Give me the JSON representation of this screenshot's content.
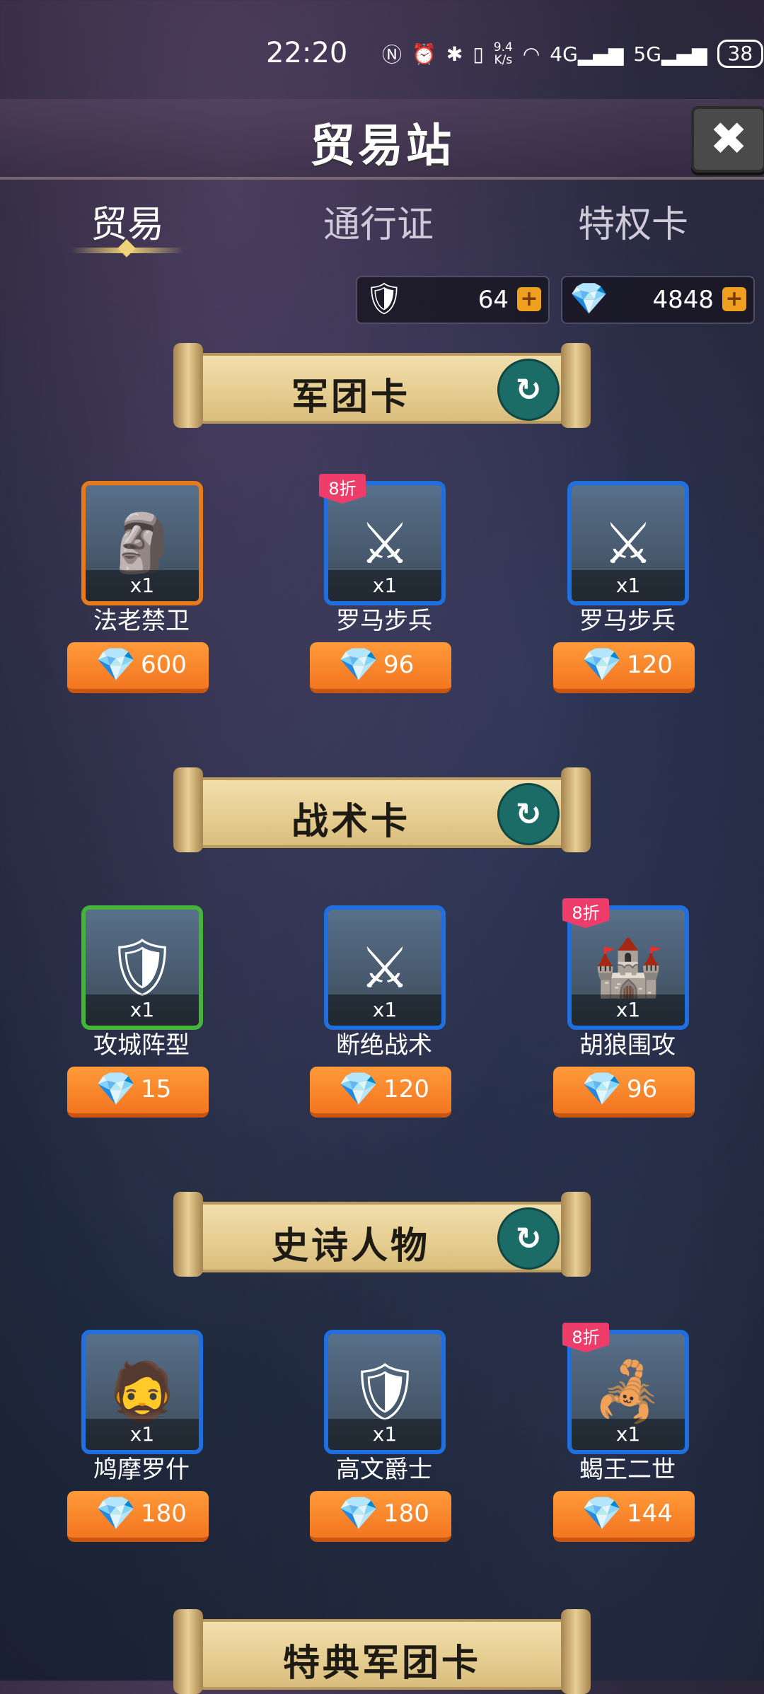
{
  "status": {
    "time": "22:20",
    "net_speed": "9.4\nK/s",
    "battery": "38"
  },
  "title": "贸易站",
  "tabs": [
    {
      "label": "贸易"
    },
    {
      "label": "通行证"
    },
    {
      "label": "特权卡"
    }
  ],
  "currencies": [
    {
      "value": "64",
      "icon": "crest-icon"
    },
    {
      "value": "4848",
      "icon": "gem-icon"
    }
  ],
  "sections": [
    {
      "title": "军团卡",
      "items": [
        {
          "name": "法老禁卫",
          "qty": "x1",
          "price": "600",
          "frame": "orange",
          "discount": ""
        },
        {
          "name": "罗马步兵",
          "qty": "x1",
          "price": "96",
          "frame": "blue",
          "discount": "8折"
        },
        {
          "name": "罗马步兵",
          "qty": "x1",
          "price": "120",
          "frame": "blue",
          "discount": ""
        }
      ]
    },
    {
      "title": "战术卡",
      "items": [
        {
          "name": "攻城阵型",
          "qty": "x1",
          "price": "15",
          "frame": "green",
          "discount": ""
        },
        {
          "name": "断绝战术",
          "qty": "x1",
          "price": "120",
          "frame": "blue",
          "discount": ""
        },
        {
          "name": "胡狼围攻",
          "qty": "x1",
          "price": "96",
          "frame": "blue",
          "discount": "8折"
        }
      ]
    },
    {
      "title": "史诗人物",
      "items": [
        {
          "name": "鸠摩罗什",
          "qty": "x1",
          "price": "180",
          "frame": "blue",
          "discount": ""
        },
        {
          "name": "高文爵士",
          "qty": "x1",
          "price": "180",
          "frame": "blue",
          "discount": ""
        },
        {
          "name": "蝎王二世",
          "qty": "x1",
          "price": "144",
          "frame": "blue",
          "discount": "8折"
        }
      ]
    },
    {
      "title": "特典军团卡",
      "items": []
    }
  ]
}
